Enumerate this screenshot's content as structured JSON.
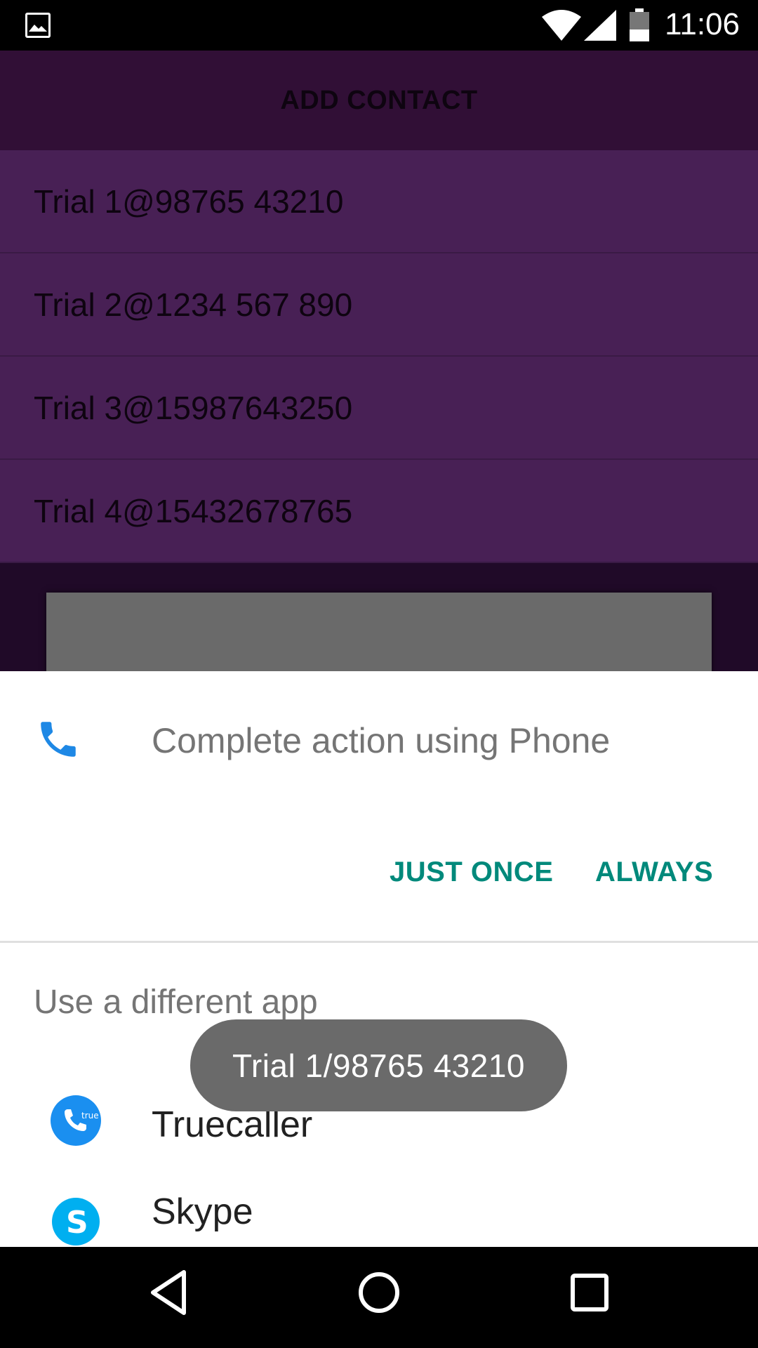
{
  "status_bar": {
    "time": "11:06",
    "icons": [
      "gallery-icon",
      "wifi-icon",
      "signal-icon",
      "battery-icon"
    ]
  },
  "app": {
    "header_title": "ADD CONTACT",
    "contacts": [
      {
        "text": "Trial 1@98765 43210"
      },
      {
        "text": "Trial 2@1234 567 890"
      },
      {
        "text": "Trial 3@15987643250"
      },
      {
        "text": "Trial 4@15432678765"
      }
    ]
  },
  "chooser": {
    "title": "Complete action using Phone",
    "just_once_label": "JUST ONCE",
    "always_label": "ALWAYS",
    "subheading": "Use a different app",
    "apps": [
      {
        "label": "Truecaller",
        "icon": "truecaller-icon"
      },
      {
        "label": "Skype",
        "icon": "skype-icon"
      }
    ],
    "accent_color": "#00897b"
  },
  "toast": {
    "text": "Trial 1/98765 43210"
  },
  "nav_bar": {
    "icons": [
      "back-icon",
      "home-icon",
      "recents-icon"
    ]
  }
}
